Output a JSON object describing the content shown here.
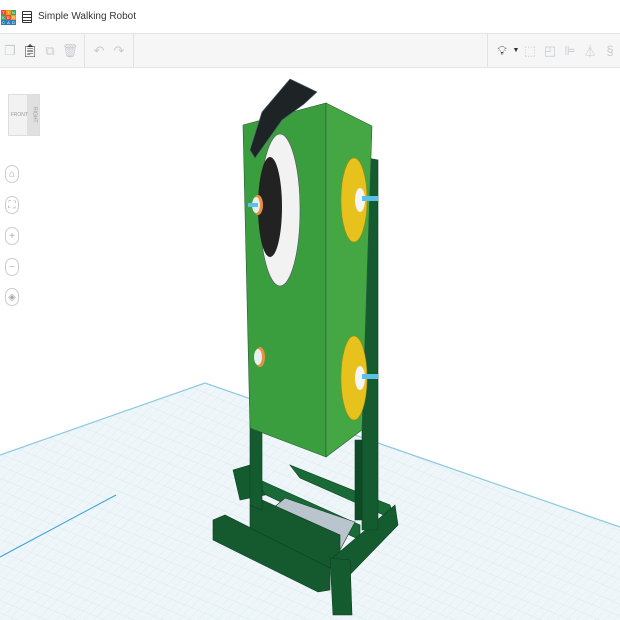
{
  "app": {
    "logo_letters": [
      "T",
      "I",
      "N",
      "K",
      "E",
      "R",
      "C",
      "A",
      "D"
    ],
    "logo_colors": [
      "#e84b3c",
      "#f39c12",
      "#27ae60",
      "#27ae60",
      "#e84b3c",
      "#f39c12",
      "#2980b9",
      "#2980b9",
      "#2980b9"
    ]
  },
  "document": {
    "title": "Simple Walking Robot"
  },
  "toolbar": {
    "left": [
      "copy-icon",
      "paste-icon",
      "duplicate-icon",
      "delete-icon",
      "undo-icon",
      "redo-icon"
    ],
    "right": [
      "light-bulb-icon",
      "group-icon",
      "ungroup-icon",
      "align-icon",
      "mirror-icon",
      "more-icon"
    ]
  },
  "viewcube": {
    "front": "FRONT",
    "right": "RIGHT"
  },
  "nav": [
    "home-view-icon",
    "fit-view-icon",
    "zoom-in-icon",
    "zoom-out-icon",
    "perspective-icon"
  ],
  "colors": {
    "body": "#3a9e3e",
    "frame": "#145c30",
    "wheel": "#e8c21c",
    "grid": "#eef6f9"
  }
}
